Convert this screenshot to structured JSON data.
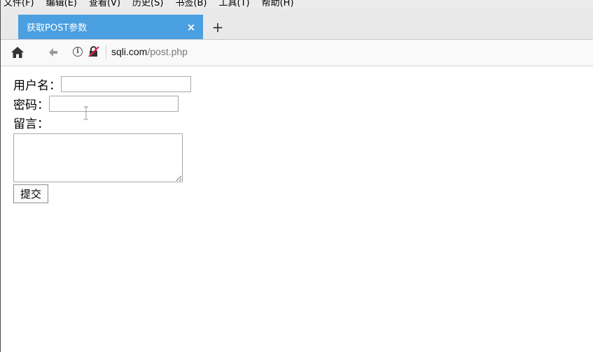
{
  "menu": {
    "items": [
      "文件(F)",
      "编辑(E)",
      "查看(V)",
      "历史(S)",
      "书签(B)",
      "工具(T)",
      "帮助(H)"
    ]
  },
  "tab": {
    "title": "获取POST参数",
    "close_glyph": "×",
    "new_tab_glyph": "+"
  },
  "navbar": {
    "info_glyph": "i",
    "url_host": "sqli.com",
    "url_path": "/post.php"
  },
  "form": {
    "username_label": "用户名：",
    "password_label": "密码：",
    "message_label": "留言：",
    "submit_label": "提交",
    "username_value": "",
    "password_value": "",
    "message_value": ""
  },
  "colors": {
    "tab_active": "#4a9fe0",
    "url_host": "#111111",
    "url_path": "#777777"
  }
}
